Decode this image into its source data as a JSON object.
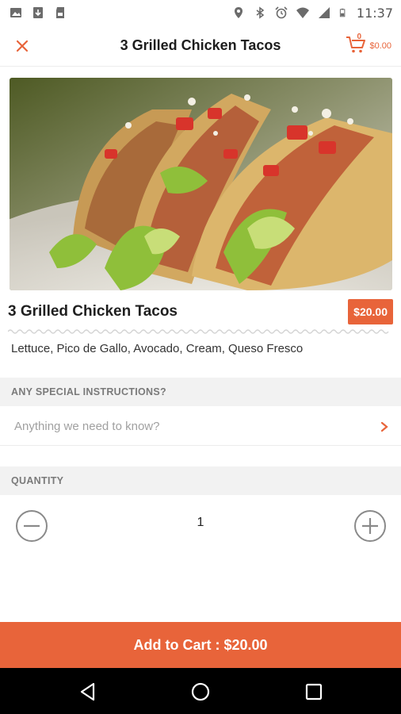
{
  "status_bar": {
    "time": "11:37",
    "left_icons": [
      "image-icon",
      "download-icon",
      "sd-card-icon"
    ],
    "right_icons": [
      "location-icon",
      "bluetooth-icon",
      "alarm-icon",
      "wifi-icon",
      "signal-icon",
      "battery-icon"
    ]
  },
  "header": {
    "title": "3 Grilled Chicken Tacos",
    "cart_count": "0",
    "cart_total": "$0.00"
  },
  "product": {
    "name": "3 Grilled Chicken Tacos",
    "price": "$20.00",
    "description": "Lettuce, Pico de Gallo, Avocado, Cream, Queso Fresco"
  },
  "instructions": {
    "heading": "ANY SPECIAL INSTRUCTIONS?",
    "placeholder": "Anything we need to know?"
  },
  "quantity": {
    "heading": "QUANTITY",
    "value": "1"
  },
  "cta": {
    "label": "Add to Cart : $20.00"
  },
  "colors": {
    "accent": "#e8643a",
    "section_bg": "#f2f2f2"
  }
}
